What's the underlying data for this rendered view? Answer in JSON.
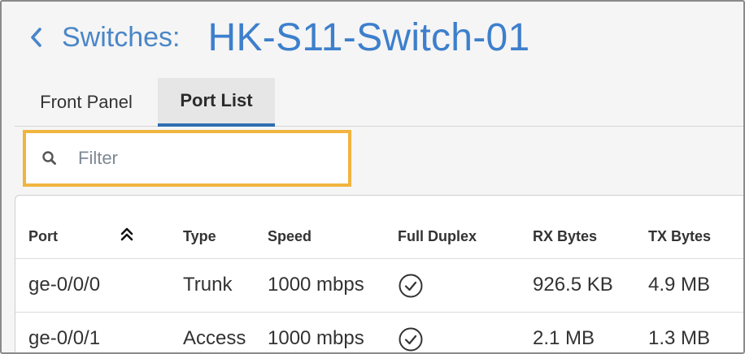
{
  "header": {
    "breadcrumb": "Switches:",
    "title": "HK-S11-Switch-01"
  },
  "tabs": [
    {
      "label": "Front Panel",
      "active": false
    },
    {
      "label": "Port List",
      "active": true
    }
  ],
  "filter": {
    "placeholder": "Filter",
    "value": ""
  },
  "table": {
    "columns": [
      "Port",
      "Type",
      "Speed",
      "Full Duplex",
      "RX Bytes",
      "TX Bytes"
    ],
    "sort_icon": "double-chevron-up-icon",
    "rows": [
      {
        "port": "ge-0/0/0",
        "type": "Trunk",
        "speed": "1000 mbps",
        "full_duplex": true,
        "rx": "926.5 KB",
        "tx": "4.9 MB"
      },
      {
        "port": "ge-0/0/1",
        "type": "Access",
        "speed": "1000 mbps",
        "full_duplex": true,
        "rx": "2.1 MB",
        "tx": "1.3 MB"
      }
    ]
  },
  "colors": {
    "accent": "#3d7fcc",
    "tab_underline": "#2f6db3",
    "filter_highlight": "#f0b43f"
  }
}
